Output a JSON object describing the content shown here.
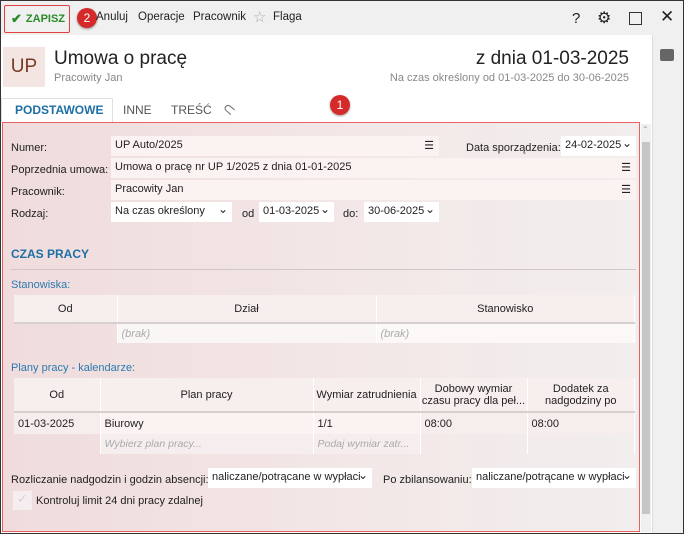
{
  "toolbar": {
    "save": "ZAPISZ",
    "badge2": "2",
    "cancel": "Anuluj",
    "operations": "Operacje",
    "employee": "Pracownik",
    "flag": "Flaga",
    "help": "?"
  },
  "header": {
    "abbr": "UP",
    "title": "Umowa o pracę",
    "subtitle": "Pracowity Jan",
    "date": "z dnia 01-03-2025",
    "period": "Na czas określony od 01-03-2025 do 30-06-2025"
  },
  "tabs": [
    "PODSTAWOWE",
    "INNE",
    "TREŚĆ"
  ],
  "badge1": "1",
  "form": {
    "numer_label": "Numer:",
    "numer": "UP Auto/2025",
    "data_label": "Data sporządzenia:",
    "data": "24-02-2025",
    "poprz_label": "Poprzednia umowa:",
    "poprz": "Umowa o pracę nr UP 1/2025 z dnia 01-01-2025",
    "prac_label": "Pracownik:",
    "prac": "Pracowity Jan",
    "rodzaj_label": "Rodzaj:",
    "rodzaj": "Na czas określony",
    "od_label": "od",
    "od": "01-03-2025",
    "do_label": "do:",
    "do": "30-06-2025"
  },
  "czas": {
    "title": "CZAS PRACY",
    "stanowiska": "Stanowiska:",
    "stan_headers": [
      "Od",
      "Dział",
      "Stanowisko"
    ],
    "stan_ph": [
      "(brak)",
      "(brak)"
    ],
    "plany": "Plany pracy - kalendarze:",
    "plan_headers": [
      "Od",
      "Plan pracy",
      "Wymiar zatrudnienia",
      "Dobowy wymiar czasu pracy dla peł...",
      "Dodatek za nadgodziny po"
    ],
    "plan_row": [
      "01-03-2025",
      "Biurowy",
      "1/1",
      "08:00",
      "08:00"
    ],
    "plan_ph": [
      "Wybierz plan pracy...",
      "Podaj wymiar zatr..."
    ],
    "rozl_label": "Rozliczanie nadgodzin i godzin absencji:",
    "rozl": "naliczane/potrącane w wypłaci",
    "zbil_label": "Po zbilansowaniu:",
    "zbil": "naliczane/potrącane w wypłaci",
    "kontrol": "Kontroluj limit 24 dni pracy zdalnej"
  }
}
